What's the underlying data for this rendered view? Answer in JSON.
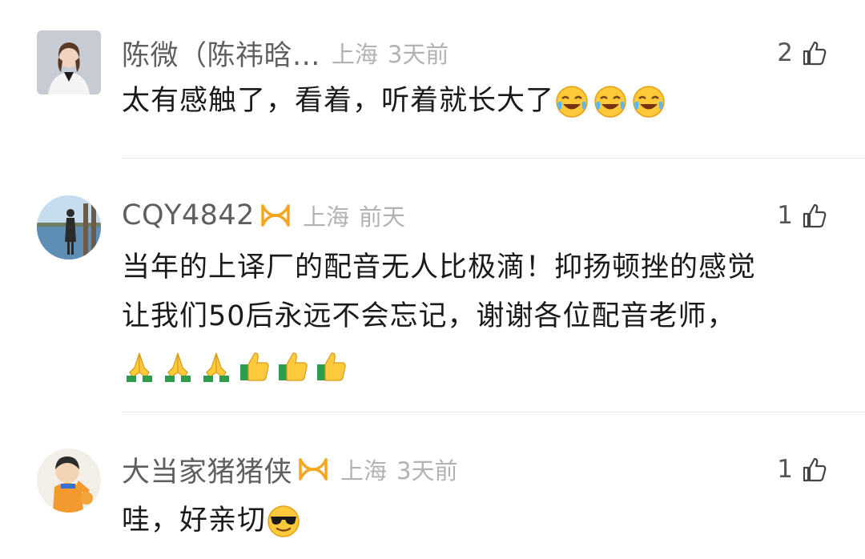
{
  "comments": [
    {
      "username": "陈微（陈祎晗...",
      "verified": false,
      "location": "上海",
      "time": "3天前",
      "likes": "2",
      "text_lines": [
        "太有感触了，看着，听着就长大了"
      ],
      "emoji": [
        "laughing-tears-emoji",
        "laughing-tears-emoji",
        "laughing-tears-emoji"
      ]
    },
    {
      "username": "CQY4842",
      "verified": true,
      "location": "上海",
      "time": "前天",
      "likes": "1",
      "text_lines": [
        "当年的上译厂的配音无人比极滴！抑扬顿挫的感觉",
        "让我们50后永远不会忘记，谢谢各位配音老师，"
      ],
      "emoji": [
        "pray-emoji",
        "pray-emoji",
        "pray-emoji",
        "thumbs-up-emoji",
        "thumbs-up-emoji",
        "thumbs-up-emoji"
      ]
    },
    {
      "username": "大当家猪猪侠",
      "verified": true,
      "location": "上海",
      "time": "3天前",
      "likes": "1",
      "text_lines": [
        "哇，好亲切"
      ],
      "emoji": [
        "sunglasses-emoji"
      ]
    }
  ],
  "colors": {
    "username": "#5f5f5f",
    "meta": "#b2b2b2",
    "body": "#1a1a1a",
    "vip_badge": "#f5a623",
    "divider": "#e6e6e6"
  }
}
